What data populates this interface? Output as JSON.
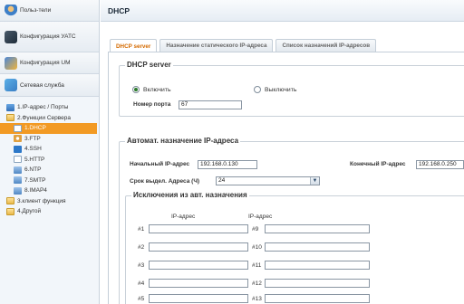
{
  "sidebar": {
    "sections": [
      {
        "label": "Польз-тели",
        "icon": "users-icon"
      },
      {
        "label": "Конфигурация УАТС",
        "icon": "pbx-icon"
      },
      {
        "label": "Конфигурация UM",
        "icon": "um-icon"
      },
      {
        "label": "Сетевая служба",
        "icon": "network-icon"
      }
    ],
    "tree": {
      "ip_ports": "1.IP-адрес / Порты",
      "server_functions": "2.Функции Сервера",
      "items": [
        {
          "label": "1.DHCP",
          "icon": "dhcp-icon",
          "active": true
        },
        {
          "label": "3.FTP",
          "icon": "ftp-icon"
        },
        {
          "label": "4.SSH",
          "icon": "ssh-icon"
        },
        {
          "label": "5.HTTP",
          "icon": "http-icon"
        },
        {
          "label": "6.NTP",
          "icon": "ntp-icon"
        },
        {
          "label": "7.SMTP",
          "icon": "smtp-icon"
        },
        {
          "label": "8.IMAP4",
          "icon": "imap4-icon"
        }
      ],
      "client_functions": "3.клиент функция",
      "other": "4.Другой"
    }
  },
  "header": {
    "title": "DHCP"
  },
  "tabs": [
    {
      "label": "DHCP server",
      "active": true
    },
    {
      "label": "Назначение статического IP-адреса"
    },
    {
      "label": "Список назначений IP-адресов"
    }
  ],
  "dhcp_server": {
    "legend": "DHCP server",
    "enable_label": "Включить",
    "disable_label": "Выключить",
    "enabled": true,
    "port_label": "Номер порта",
    "port_value": "67"
  },
  "auto_assign": {
    "legend": "Автомат. назначение IP-адреса",
    "start_label": "Начальный IP-адрес",
    "start_value": "192.168.0.130",
    "end_label": "Конечный IP-адрес",
    "end_value": "192.168.0.250",
    "lease_label": "Срок выдел. Адреса (Ч)",
    "lease_value": "24"
  },
  "exclusions": {
    "legend": "Исключения из авт. назначения",
    "col_header": "IP-адрес",
    "left_numbers": [
      "#1",
      "#2",
      "#3",
      "#4",
      "#5"
    ],
    "right_numbers": [
      "#9",
      "#10",
      "#11",
      "#12",
      "#13"
    ]
  },
  "colors": {
    "active_item": "#f29a24",
    "active_tab_text": "#d46a00"
  }
}
